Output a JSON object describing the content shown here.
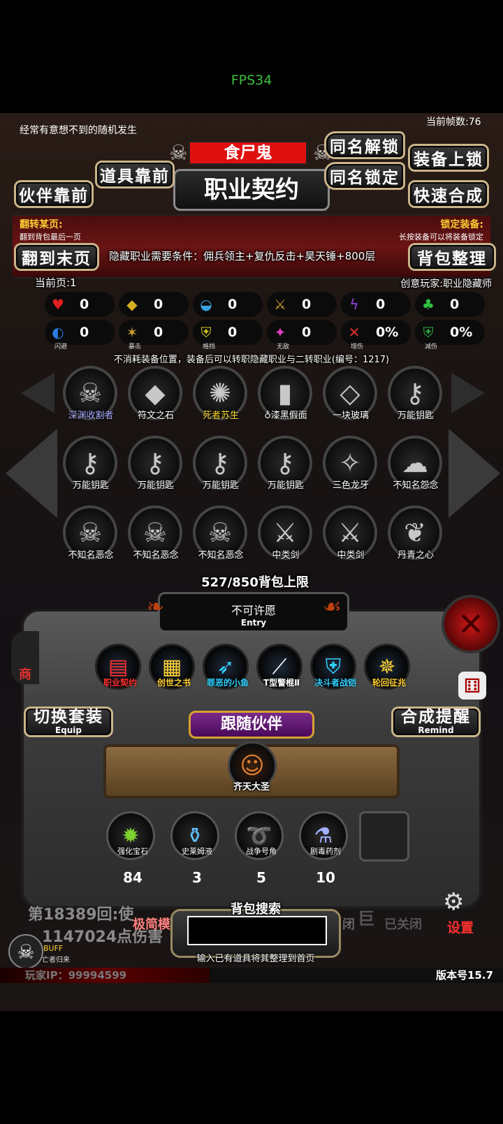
{
  "status": {
    "fps": "FPS34"
  },
  "top": {
    "random_event": "经常有意想不到的随机发生",
    "frame_count": "当前帧数:76",
    "monster_name": "食尸鬼",
    "title": "职业契约",
    "btn_unlock_same": "同名解锁",
    "btn_lock_same": "同名锁定",
    "btn_equip_lock": "装备上锁",
    "btn_quick_merge": "快速合成",
    "btn_item_front": "道具靠前",
    "btn_partner_front": "伙伴靠前"
  },
  "banner": {
    "flip_label": "翻转某页:",
    "flip_hint": "翻到背包最后一页",
    "lock_label": "锁定装备:",
    "lock_hint": "长按装备可以将装备锁定",
    "btn_last_page": "翻到末页",
    "hidden_req": "隐藏职业需要条件：佣兵领主+复仇反击+昊天锤+800层",
    "btn_sort": "背包整理",
    "current_page": "当前页:1",
    "creator": "创意玩家:职业隐藏师"
  },
  "stats_row1": [
    {
      "icon": "heart-icon",
      "glyph": "♥",
      "color": "#e02020",
      "value": "0"
    },
    {
      "icon": "armor-icon",
      "glyph": "◆",
      "color": "#d6b020",
      "value": "0"
    },
    {
      "icon": "helmet-icon",
      "glyph": "◒",
      "color": "#3aa0e0",
      "value": "0"
    },
    {
      "icon": "sword-icon",
      "glyph": "⚔",
      "color": "#c8a030",
      "value": "0"
    },
    {
      "icon": "lightning-icon",
      "glyph": "ϟ",
      "color": "#9a40e0",
      "value": "0"
    },
    {
      "icon": "clover-icon",
      "glyph": "♣",
      "color": "#30c040",
      "value": "0"
    }
  ],
  "stats_row2": [
    {
      "icon": "dodge-icon",
      "glyph": "◐",
      "color": "#2a7be0",
      "value": "0",
      "sub": "闪避"
    },
    {
      "icon": "crit-icon",
      "glyph": "✶",
      "color": "#d0a030",
      "value": "0",
      "sub": "暴击"
    },
    {
      "icon": "block-icon",
      "glyph": "⛨",
      "color": "#d8c820",
      "value": "0",
      "sub": "格挡"
    },
    {
      "icon": "invincible-icon",
      "glyph": "✦",
      "color": "#e040c0",
      "value": "0",
      "sub": "无敌"
    },
    {
      "icon": "dmg-up-icon",
      "glyph": "✕",
      "color": "#e03030",
      "value": "0%",
      "sub": "增伤"
    },
    {
      "icon": "dmg-reduce-icon",
      "glyph": "⛨",
      "color": "#30b040",
      "value": "0%",
      "sub": "减伤"
    }
  ],
  "notice": "不消耗装备位置，装备后可以转职隐藏职业与二转职业(编号：1217)",
  "items": [
    {
      "label": "深渊收割者",
      "glyph": "☠",
      "color": "#aaaaff"
    },
    {
      "label": "符文之石",
      "glyph": "◆",
      "color": "#ffffff"
    },
    {
      "label": "死者苏生",
      "glyph": "✺",
      "color": "#ffdd33"
    },
    {
      "label": "♁漆黑假面",
      "glyph": "▮",
      "color": "#ffffff"
    },
    {
      "label": "一块玻璃",
      "glyph": "◇",
      "color": "#ffffff"
    },
    {
      "label": "万能钥匙",
      "glyph": "⚷",
      "color": "#ffffff"
    },
    {
      "label": "万能钥匙",
      "glyph": "⚷",
      "color": "#ffffff"
    },
    {
      "label": "万能钥匙",
      "glyph": "⚷",
      "color": "#ffffff"
    },
    {
      "label": "万能钥匙",
      "glyph": "⚷",
      "color": "#ffffff"
    },
    {
      "label": "万能钥匙",
      "glyph": "⚷",
      "color": "#ffffff"
    },
    {
      "label": "三色龙牙",
      "glyph": "✧",
      "color": "#ffffff"
    },
    {
      "label": "不知名怨念",
      "glyph": "☁",
      "color": "#ffffff"
    },
    {
      "label": "不知名恶念",
      "glyph": "☠",
      "color": "#ffffff"
    },
    {
      "label": "不知名恶念",
      "glyph": "☠",
      "color": "#ffffff"
    },
    {
      "label": "不知名恶念",
      "glyph": "☠",
      "color": "#ffffff"
    },
    {
      "label": "中类剑",
      "glyph": "⚔",
      "color": "#ffffff"
    },
    {
      "label": "中类剑",
      "glyph": "⚔",
      "color": "#ffffff"
    },
    {
      "label": "丹青之心",
      "glyph": "❦",
      "color": "#ffffff"
    }
  ],
  "capacity": "527/850背包上限",
  "wish": {
    "label": "不可许愿",
    "sub": "Entry"
  },
  "equipped": [
    {
      "label": "职业契约",
      "glyph": "▤",
      "color": "#ff3030"
    },
    {
      "label": "创世之书",
      "glyph": "▦",
      "color": "#ffd030"
    },
    {
      "label": "罪恶的小鱼",
      "glyph": "➶",
      "color": "#30d0ff"
    },
    {
      "label": "T型警棍Ⅱ",
      "glyph": "⟋",
      "color": "#ffffff"
    },
    {
      "label": "决斗者战铠",
      "glyph": "⛨",
      "color": "#30d0ff"
    },
    {
      "label": "轮回征兆",
      "glyph": "✵",
      "color": "#ffd030"
    }
  ],
  "panel": {
    "switch_set": "切换套装",
    "switch_set_sub": "Equip",
    "follow_partner": "跟随伙伴",
    "merge_remind": "合成提醒",
    "merge_remind_sub": "Remind",
    "partner_name": "齐天大圣"
  },
  "consumables": [
    {
      "label": "强化宝石",
      "glyph": "✹",
      "color": "#7cd030",
      "count": "84"
    },
    {
      "label": "史莱姆液",
      "glyph": "⚱",
      "color": "#60c0ff",
      "count": "3"
    },
    {
      "label": "战争号角",
      "glyph": "➰",
      "color": "#d080ff",
      "count": "5"
    },
    {
      "label": "剧毒药剂",
      "glyph": "⚗",
      "color": "#a0b0ff",
      "count": "10"
    }
  ],
  "shop_label": "商",
  "bottom": {
    "battle_log_1": "第18389回:使",
    "battle_log_2": "1147024点伤害",
    "minimal": "极简模",
    "closed": "已关闭",
    "closed_short": "闭",
    "giant": "巨",
    "search_title": "背包搜索",
    "search_hint": "输入已有道具将其整理到首页",
    "settings": "设置",
    "buff": "BUFF",
    "buff_desc": "亡者归来",
    "player_ip": "玩家IP：99994599",
    "version": "版本号15.7"
  }
}
